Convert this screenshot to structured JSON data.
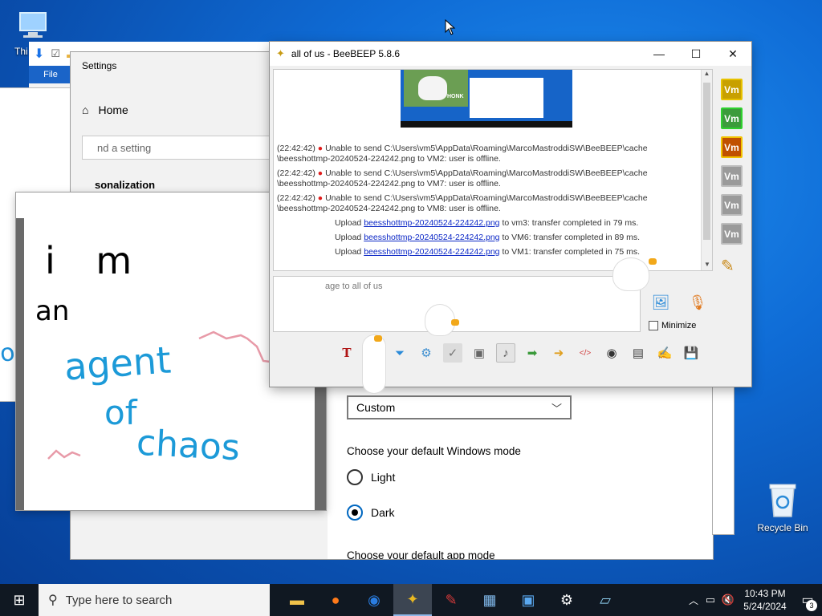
{
  "desktop": {
    "this_pc_label": "Thi",
    "recycle_bin_label": "Recycle Bin"
  },
  "explorer": {
    "file_tab": "File",
    "partial_text": "D"
  },
  "settings": {
    "title": "Settings",
    "home": "Home",
    "find_placeholder": "nd a setting",
    "section": "sonalization",
    "dropdown_value": "Custom",
    "windows_mode_heading": "Choose your default Windows mode",
    "options": [
      "Light",
      "Dark"
    ],
    "selected_option": "Dark",
    "app_mode_heading": "Choose your default app mode"
  },
  "paint": {
    "handwriting": [
      "i m",
      "an",
      "agent",
      "of",
      "chaos"
    ]
  },
  "beebeep": {
    "title": "all of us - BeeBEEP 5.8.6",
    "chat_lines": [
      {
        "time": "(22:42:42)",
        "text": "Unable to send C:\\Users\\vm5\\AppData\\Roaming\\MarcoMastroddiSW\\BeeBEEP\\cache",
        "text2": "\\beesshottmp-20240524-224242.png to VM2: user is offline."
      },
      {
        "time": "(22:42:42)",
        "text": "Unable to send C:\\Users\\vm5\\AppData\\Roaming\\MarcoMastroddiSW\\BeeBEEP\\cache",
        "text2": "\\beesshottmp-20240524-224242.png to VM7: user is offline."
      },
      {
        "time": "(22:42:42)",
        "text": "Unable to send C:\\Users\\vm5\\AppData\\Roaming\\MarcoMastroddiSW\\BeeBEEP\\cache",
        "text2": "\\beesshottmp-20240524-224242.png to VM8: user is offline."
      }
    ],
    "uploads": [
      {
        "prefix": "Upload",
        "file": "beesshottmp-20240524-224242.png",
        "suffix": "to vm3: transfer completed in 79 ms."
      },
      {
        "prefix": "Upload",
        "file": "beesshottmp-20240524-224242.png",
        "suffix": "to VM6: transfer completed in 89 ms."
      },
      {
        "prefix": "Upload",
        "file": "beesshottmp-20240524-224242.png",
        "suffix": "to VM1: transfer completed in 75 ms."
      }
    ],
    "message_placeholder": "age to all of us",
    "minimize_label": "Minimize",
    "vm_badge": "Vm",
    "vm_badges": [
      {
        "color": "#c8a000",
        "border": "#e7c200"
      },
      {
        "color": "#3c9b3c",
        "border": "#2ed12e"
      },
      {
        "color": "#c05000",
        "border": "#f2c300"
      },
      {
        "color": "#9a9a9a",
        "border": "#bdbdbd"
      },
      {
        "color": "#9a9a9a",
        "border": "#bdbdbd"
      },
      {
        "color": "#9a9a9a",
        "border": "#bdbdbd"
      }
    ],
    "thumbnail_label": "HONK"
  },
  "taskbar": {
    "search_placeholder": "Type here to search",
    "time": "10:43 PM",
    "date": "5/24/2024",
    "notification_count": "3"
  }
}
